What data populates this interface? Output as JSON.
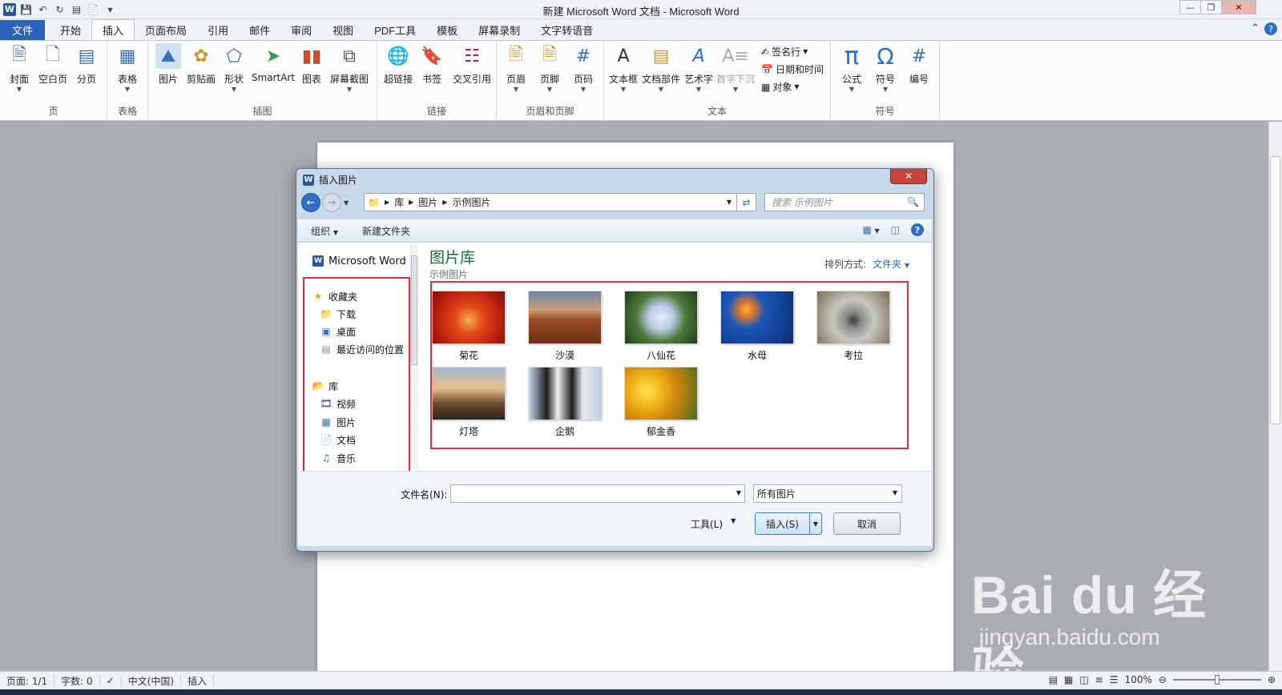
{
  "window": {
    "title": "新建 Microsoft Word 文档 - Microsoft Word",
    "app_logo": "W"
  },
  "ribbon_tabs": [
    "文件",
    "开始",
    "插入",
    "页面布局",
    "引用",
    "邮件",
    "审阅",
    "视图",
    "PDF工具",
    "模板",
    "屏幕录制",
    "文字转语音"
  ],
  "active_tab": "插入",
  "ribbon": {
    "pages": {
      "label": "页",
      "cover": "封面",
      "blank": "空白页",
      "break": "分页"
    },
    "tables": {
      "label": "表格",
      "table": "表格"
    },
    "illustrations": {
      "label": "插图",
      "picture": "图片",
      "clipart": "剪贴画",
      "shapes": "形状",
      "smartart": "SmartArt",
      "chart": "图表",
      "screenshot": "屏幕截图"
    },
    "links": {
      "label": "链接",
      "hyperlink": "超链接",
      "bookmark": "书签",
      "crossref": "交叉引用"
    },
    "header_footer": {
      "label": "页眉和页脚",
      "header": "页眉",
      "footer": "页脚",
      "page_number": "页码"
    },
    "text": {
      "label": "文本",
      "textbox": "文本框",
      "quickparts": "文档部件",
      "wordart": "艺术字",
      "dropcap": "首字下沉",
      "signature": "签名行",
      "datetime": "日期和时间",
      "object": "对象"
    },
    "symbols": {
      "label": "符号",
      "equation": "公式",
      "symbol": "符号",
      "number": "编号"
    }
  },
  "dialog": {
    "title": "插入图片",
    "breadcrumb": [
      "库",
      "图片",
      "示例图片"
    ],
    "search_placeholder": "搜索 示例图片",
    "organize": "组织",
    "new_folder": "新建文件夹",
    "nav": {
      "word": "Microsoft Word",
      "favorites": "收藏夹",
      "downloads": "下载",
      "desktop": "桌面",
      "recent": "最近访问的位置",
      "libraries": "库",
      "videos": "视频",
      "pictures": "图片",
      "documents": "文档",
      "music": "音乐"
    },
    "library_title": "图片库",
    "library_sub": "示例图片",
    "arrange_label": "排列方式:",
    "arrange_value": "文件夹",
    "thumbnails": [
      "菊花",
      "沙漠",
      "八仙花",
      "水母",
      "考拉",
      "灯塔",
      "企鹅",
      "郁金香"
    ],
    "filename_label": "文件名(N):",
    "filename_value": "",
    "filter_value": "所有图片",
    "tools": "工具(L)",
    "insert": "插入(S)",
    "cancel": "取消"
  },
  "status": {
    "page": "页面: 1/1",
    "words": "字数: 0",
    "lang": "中文(中国)",
    "mode": "插入",
    "zoom": "100%"
  },
  "watermark": {
    "brand": "Bai du 经验",
    "url": "jingyan.baidu.com"
  }
}
